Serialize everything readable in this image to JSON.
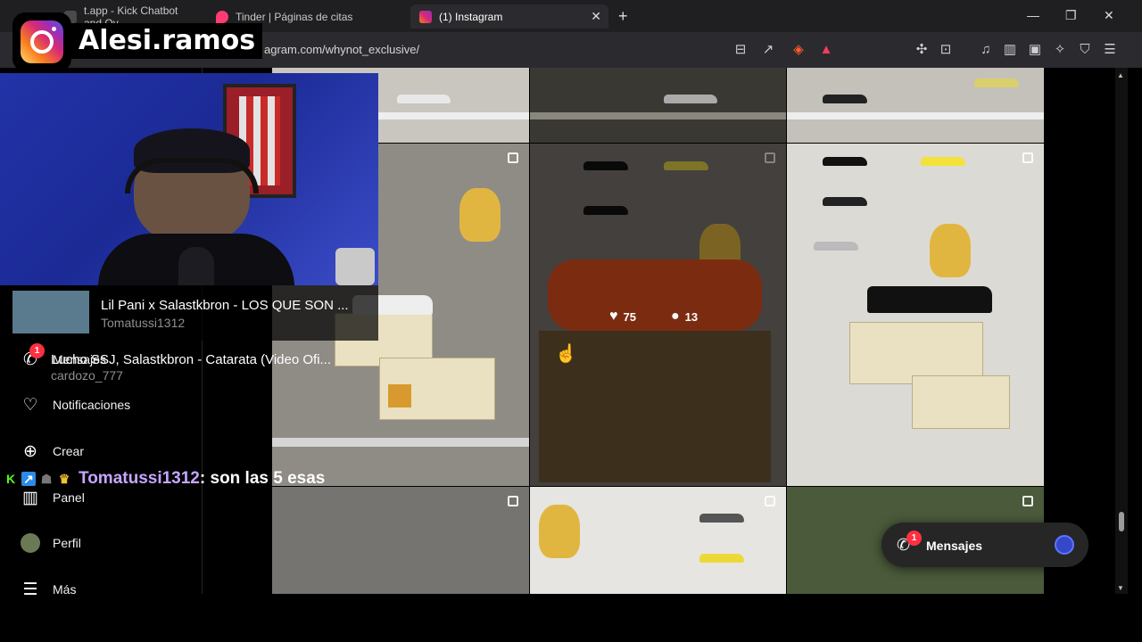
{
  "browser": {
    "tabs": [
      {
        "label": "t.app - Kick Chatbot and Ov",
        "fav_color": "#4a4a4a"
      },
      {
        "label": "Tinder | Páginas de citas",
        "fav_color": "#fe3c72"
      },
      {
        "label": "(1) Instagram",
        "fav_color": "#d62976",
        "active": true
      }
    ],
    "url": "agram.com/whynot_exclusive/"
  },
  "sidebar": {
    "items": [
      {
        "label": "Mensajes",
        "icon": "messenger-icon",
        "badge": "1"
      },
      {
        "label": "Notificaciones",
        "icon": "heart-icon"
      },
      {
        "label": "Crear",
        "icon": "plus-square-icon"
      },
      {
        "label": "Panel",
        "icon": "bar-chart-icon"
      },
      {
        "label": "Perfil",
        "icon": "avatar-icon"
      },
      {
        "label": "Más",
        "icon": "menu-icon"
      }
    ]
  },
  "post_hover": {
    "likes": "75",
    "comments": "13"
  },
  "messages_button": {
    "label": "Mensajes",
    "badge": "1"
  },
  "stream": {
    "channel_name": "Alesi.ramos",
    "now_playing": {
      "title": "Lil Pani x Salastkbron - LOS QUE SON ...",
      "requester": "Tomatussi1312"
    },
    "next_song": {
      "title": "Lucho SSJ, Salastkbron - Catarata (Video Ofi...",
      "requester": "cardozo_777"
    },
    "chat": {
      "user": "Tomatussi1312",
      "message": ": son las 5 esas"
    }
  }
}
